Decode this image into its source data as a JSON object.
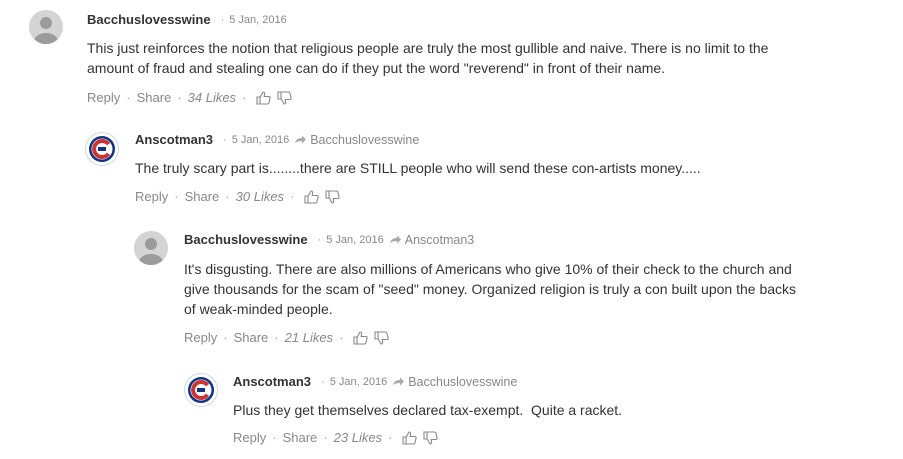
{
  "comments": [
    {
      "author": "Bacchuslovesswine",
      "date": "5 Jan, 2016",
      "reply_to": "",
      "avatar": "gray-user-icon",
      "lines": [
        "This just reinforces the notion that religious people are truly the most gullible and naive. There is no limit to the",
        "amount of fraud and stealing one can do if they put the word \"reverend\" in front of their name."
      ],
      "reply_label": "Reply",
      "share_label": "Share",
      "likes": "34 Likes"
    },
    {
      "author": "Anscotman3",
      "date": "5 Jan, 2016",
      "reply_to": "Bacchuslovesswine",
      "avatar": "cubs-logo-icon",
      "lines": [
        "The truly scary part is........there are STILL people who will send these con-artists money....."
      ],
      "reply_label": "Reply",
      "share_label": "Share",
      "likes": "30 Likes"
    },
    {
      "author": "Bacchuslovesswine",
      "date": "5 Jan, 2016",
      "reply_to": "Anscotman3",
      "avatar": "gray-user-icon",
      "lines": [
        "It's disgusting. There are also millions of Americans who give 10% of their check to the church and",
        "give thousands for the scam of \"seed\" money. Organized religion is truly a con built upon the backs",
        "of weak-minded people."
      ],
      "reply_label": "Reply",
      "share_label": "Share",
      "likes": "21 Likes"
    },
    {
      "author": "Anscotman3",
      "date": "5 Jan, 2016",
      "reply_to": "Bacchuslovesswine",
      "avatar": "cubs-logo-icon",
      "lines": [
        "Plus they get themselves declared tax-exempt.  Quite a racket."
      ],
      "reply_label": "Reply",
      "share_label": "Share",
      "likes": "23 Likes"
    }
  ],
  "colors": {
    "text": "#333333",
    "meta": "#888888",
    "cubs_blue": "#0e3386",
    "cubs_red": "#cc3433"
  }
}
